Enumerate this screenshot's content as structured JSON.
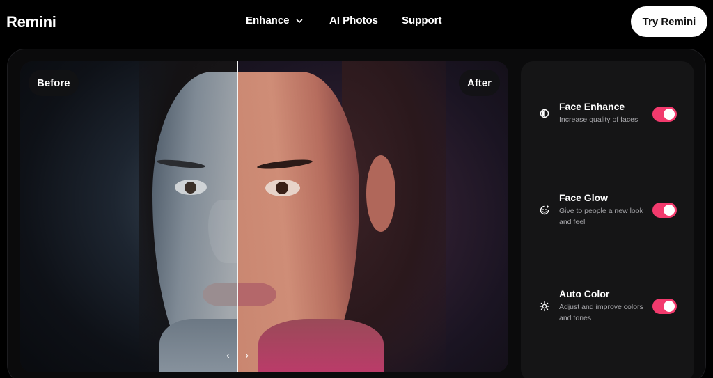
{
  "header": {
    "logo": "Remini",
    "nav": [
      {
        "label": "Enhance"
      },
      {
        "label": "AI Photos"
      },
      {
        "label": "Support"
      }
    ],
    "cta_label": "Try Remini"
  },
  "compare": {
    "before_label": "Before",
    "after_label": "After",
    "handle_left": "‹",
    "handle_right": "›"
  },
  "options": [
    {
      "title": "Face Enhance",
      "description": "Increase quality of faces",
      "icon": "face-enhance-icon",
      "enabled": true
    },
    {
      "title": "Face Glow",
      "description": "Give to people a new look and feel",
      "icon": "face-glow-icon",
      "enabled": true
    },
    {
      "title": "Auto Color",
      "description": "Adjust and improve colors and tones",
      "icon": "auto-color-icon",
      "enabled": true
    }
  ],
  "colors": {
    "accent": "#f23a6d",
    "background": "#000000",
    "panel": "#151516"
  }
}
